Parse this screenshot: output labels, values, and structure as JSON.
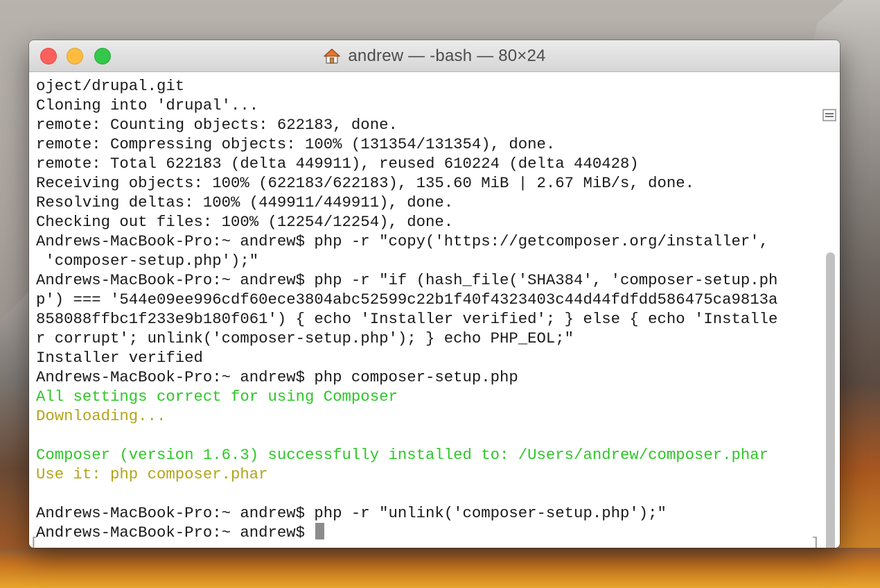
{
  "window": {
    "title": "andrew — -bash — 80×24"
  },
  "terminal": {
    "lines": [
      {
        "text": "oject/drupal.git",
        "color": "default"
      },
      {
        "text": "Cloning into 'drupal'...",
        "color": "default"
      },
      {
        "text": "remote: Counting objects: 622183, done.",
        "color": "default"
      },
      {
        "text": "remote: Compressing objects: 100% (131354/131354), done.",
        "color": "default"
      },
      {
        "text": "remote: Total 622183 (delta 449911), reused 610224 (delta 440428)",
        "color": "default"
      },
      {
        "text": "Receiving objects: 100% (622183/622183), 135.60 MiB | 2.67 MiB/s, done.",
        "color": "default"
      },
      {
        "text": "Resolving deltas: 100% (449911/449911), done.",
        "color": "default"
      },
      {
        "text": "Checking out files: 100% (12254/12254), done.",
        "color": "default"
      },
      {
        "text": "Andrews-MacBook-Pro:~ andrew$ php -r \"copy('https://getcomposer.org/installer',",
        "color": "default"
      },
      {
        "text": " 'composer-setup.php');\"",
        "color": "default"
      },
      {
        "text": "Andrews-MacBook-Pro:~ andrew$ php -r \"if (hash_file('SHA384', 'composer-setup.ph",
        "color": "default"
      },
      {
        "text": "p') === '544e09ee996cdf60ece3804abc52599c22b1f40f4323403c44d44fdfdd586475ca9813a",
        "color": "default"
      },
      {
        "text": "858088ffbc1f233e9b180f061') { echo 'Installer verified'; } else { echo 'Installe",
        "color": "default"
      },
      {
        "text": "r corrupt'; unlink('composer-setup.php'); } echo PHP_EOL;\"",
        "color": "default"
      },
      {
        "text": "Installer verified",
        "color": "default"
      },
      {
        "text": "Andrews-MacBook-Pro:~ andrew$ php composer-setup.php",
        "color": "default"
      },
      {
        "text": "All settings correct for using Composer",
        "color": "green"
      },
      {
        "text": "Downloading...",
        "color": "yellow"
      },
      {
        "text": "",
        "color": "default"
      },
      {
        "text": "Composer (version 1.6.3) successfully installed to: /Users/andrew/composer.phar",
        "color": "green"
      },
      {
        "text": "Use it: php composer.phar",
        "color": "yellow"
      },
      {
        "text": "",
        "color": "default"
      },
      {
        "text": "Andrews-MacBook-Pro:~ andrew$ php -r \"unlink('composer-setup.php');\"",
        "color": "default"
      },
      {
        "text": "Andrews-MacBook-Pro:~ andrew$ ",
        "color": "default",
        "cursor": true
      }
    ],
    "bookmark_left": "[",
    "bookmark_right": "]"
  },
  "colors": {
    "green": "#2fc629",
    "yellow": "#b3a41b",
    "close": "#fc605c",
    "minimize": "#fdbc40",
    "zoom": "#34c84a"
  },
  "icons": {
    "title_icon": "home-icon",
    "scroll_split": "split-pane-icon"
  }
}
